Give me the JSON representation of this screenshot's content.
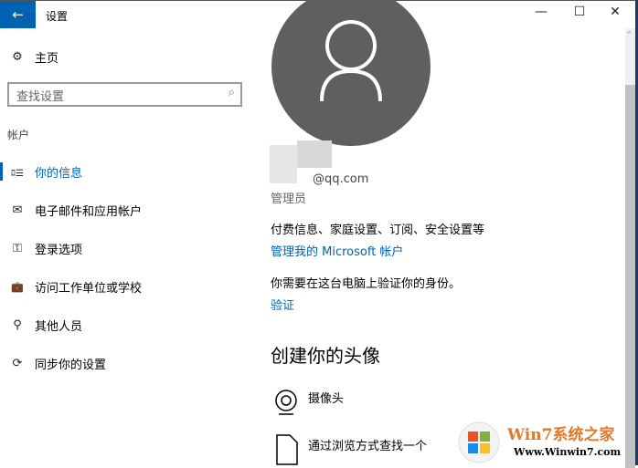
{
  "window": {
    "title": "设置",
    "minimize": "—",
    "maximize": "☐",
    "close": "✕",
    "back": "←"
  },
  "sidebar": {
    "home": "主页",
    "search_placeholder": "查找设置",
    "section": "帐户",
    "items": [
      {
        "label": "你的信息",
        "icon": "person-list-icon",
        "glyph": "ﾛ☰"
      },
      {
        "label": "电子邮件和应用帐户",
        "icon": "mail-icon",
        "glyph": "✉"
      },
      {
        "label": "登录选项",
        "icon": "key-icon",
        "glyph": "⚿"
      },
      {
        "label": "访问工作单位或学校",
        "icon": "briefcase-icon",
        "glyph": "💼"
      },
      {
        "label": "其他人员",
        "icon": "person-add-icon",
        "glyph": "⚲"
      },
      {
        "label": "同步你的设置",
        "icon": "sync-icon",
        "glyph": "⟳"
      }
    ]
  },
  "main": {
    "email": "@qq.com",
    "role": "管理员",
    "billing_text": "付费信息、家庭设置、订阅、安全设置等",
    "manage_link": "管理我的 Microsoft 帐户",
    "verify_text": "你需要在这台电脑上验证你的身份。",
    "verify_link": "验证",
    "avatar_heading": "创建你的头像",
    "camera": "摄像头",
    "browse": "通过浏览方式查找一个"
  },
  "watermark": {
    "brand": "Win7系统之家",
    "url": "Www.Winwin7.com"
  }
}
